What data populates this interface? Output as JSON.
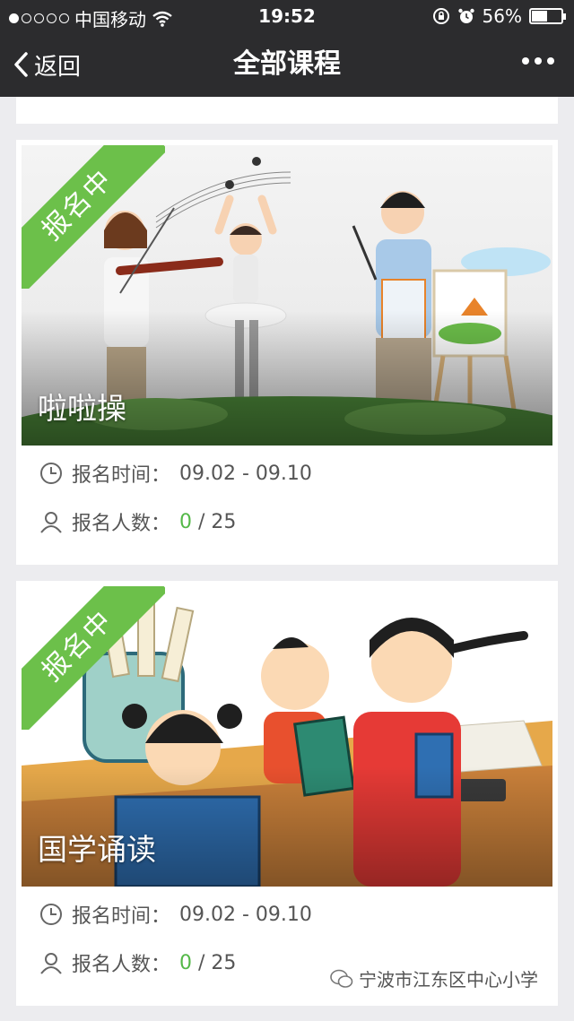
{
  "status": {
    "carrier": "中国移动",
    "time": "19:52",
    "battery": "56%",
    "battery_level": 0.56
  },
  "nav": {
    "back_label": "返回",
    "title": "全部课程"
  },
  "courses": [
    {
      "badge": "报名中",
      "title": "啦啦操",
      "time_label": "报名时间：",
      "time_value": "09.02 - 09.10",
      "count_label": "报名人数：",
      "count_now": "0",
      "count_sep": " / ",
      "count_total": "25"
    },
    {
      "badge": "报名中",
      "title": "国学诵读",
      "time_label": "报名时间：",
      "time_value": "09.02 - 09.10",
      "count_label": "报名人数：",
      "count_now": "0",
      "count_sep": " / ",
      "count_total": "25"
    }
  ],
  "watermark": "宁波市江东区中心小学",
  "colors": {
    "navbar": "#2c2c2e",
    "badge": "#6cc04a",
    "count_now": "#54b848",
    "background": "#ececef"
  }
}
